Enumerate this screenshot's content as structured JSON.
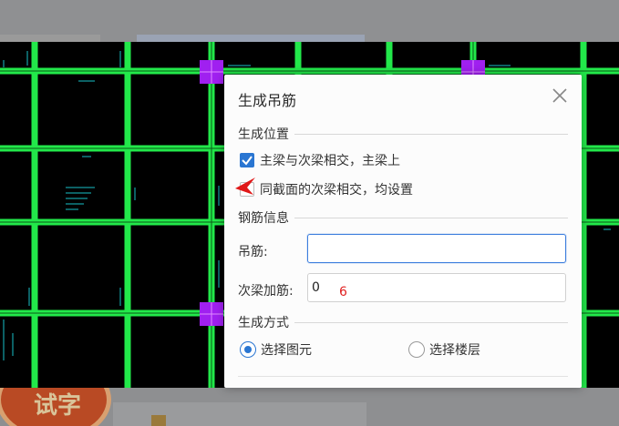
{
  "background": {
    "badge_text": "试字"
  },
  "dialog": {
    "title": "生成吊筋",
    "sections": {
      "position": "生成位置",
      "rebar_info": "钢筋信息",
      "method": "生成方式"
    },
    "checkboxes": [
      {
        "label": "主梁与次梁相交，主梁上",
        "checked": true
      },
      {
        "label": "同截面的次梁相交，均设置",
        "checked": false
      }
    ],
    "fields": {
      "hanger_label": "吊筋:",
      "hanger_value": "",
      "secondary_label": "次梁加筋:",
      "secondary_value": "0"
    },
    "radios": [
      {
        "label": "选择图元",
        "selected": true
      },
      {
        "label": "选择楼层",
        "selected": false
      }
    ]
  },
  "annotation": {
    "red_number": "6"
  },
  "colors": {
    "beam": "#22e84a",
    "column": "#a020f0",
    "accent": "#2a76d2"
  }
}
